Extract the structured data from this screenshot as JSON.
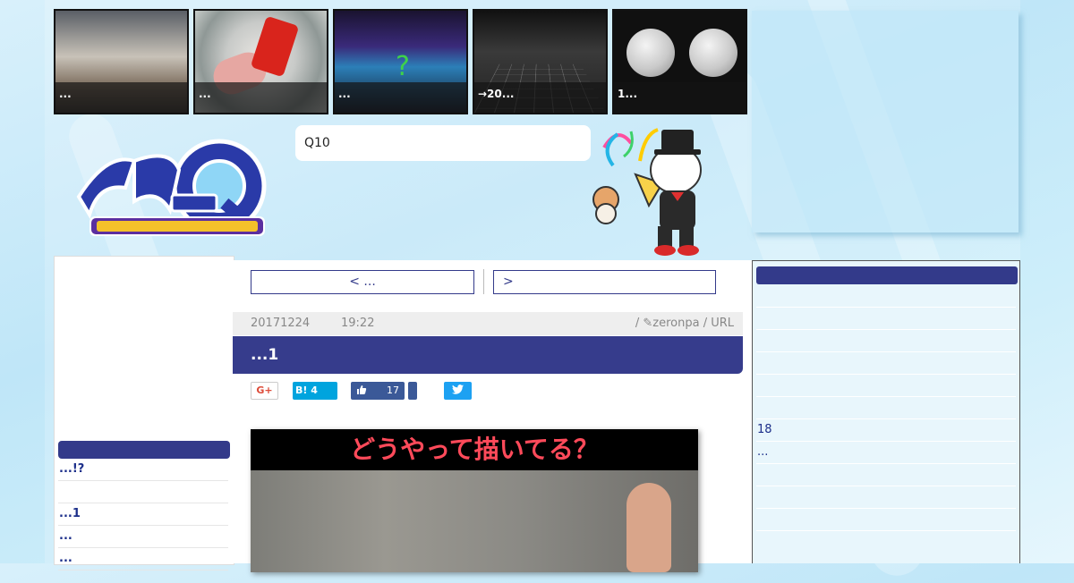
{
  "thumbs": [
    {
      "caption": "..."
    },
    {
      "caption": "..."
    },
    {
      "caption": "..."
    },
    {
      "caption": "→20..."
    },
    {
      "caption": "1..."
    }
  ],
  "search": {
    "value": "Q10"
  },
  "left_sidebar": {
    "items": [
      "...!?",
      "",
      "...1",
      "...",
      "..."
    ]
  },
  "nav": {
    "prev_label": "< ...",
    "next_label": ">"
  },
  "post": {
    "date": "20171224",
    "time": "19:22",
    "author_line": "/ ✎zeronpa / URL",
    "title": "...1",
    "image_heading": "どうやって描いてる？"
  },
  "share": {
    "gplus_label": "G+",
    "hatena_label": "B! 4",
    "like_count": "17"
  },
  "right_sidebar": {
    "items": [
      "",
      "",
      "",
      "",
      "",
      "",
      "18",
      "...",
      "",
      "",
      ""
    ]
  },
  "colors": {
    "accent": "#363c8c",
    "link": "#1c2f8a"
  }
}
